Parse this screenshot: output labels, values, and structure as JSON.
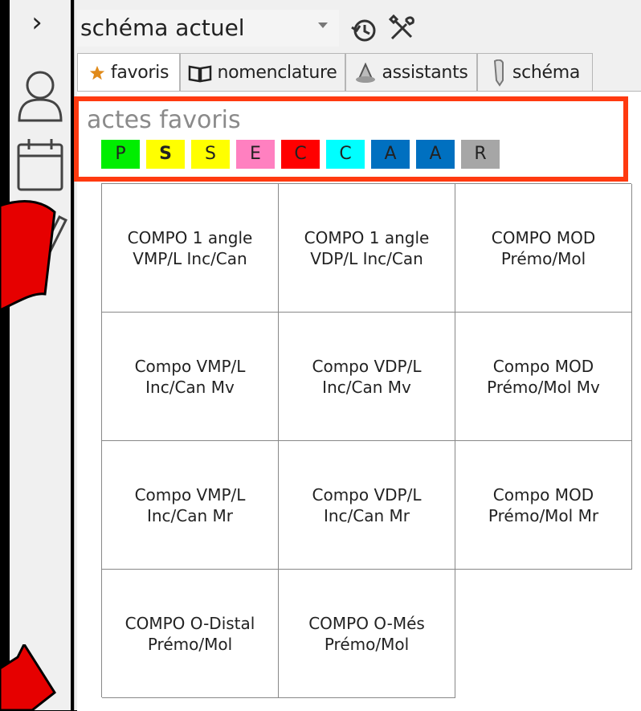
{
  "left_panel": {
    "expand_glyph": "›",
    "icons": [
      "chevron-right-icon",
      "user-icon",
      "calendar-icon",
      "person-edit-icon"
    ]
  },
  "schema": {
    "selected": "schéma actuel",
    "icons": [
      "history-icon",
      "tools-icon"
    ]
  },
  "tabs": [
    {
      "label": "favoris",
      "icon": "star-icon",
      "active": true
    },
    {
      "label": "nomenclature",
      "icon": "book-icon",
      "active": false
    },
    {
      "label": "assistants",
      "icon": "wizard-icon",
      "active": false
    },
    {
      "label": "schéma",
      "icon": "tooth-icon",
      "active": false
    }
  ],
  "favorites": {
    "title": "actes favoris",
    "swatches": [
      {
        "letter": "P",
        "color": "#00ee00",
        "bold": false
      },
      {
        "letter": "S",
        "color": "#ffff00",
        "bold": true
      },
      {
        "letter": "S",
        "color": "#ffff00",
        "bold": false
      },
      {
        "letter": "E",
        "color": "#ff80c0",
        "bold": false
      },
      {
        "letter": "C",
        "color": "#ff0000",
        "bold": false
      },
      {
        "letter": "C",
        "color": "#00ffff",
        "bold": false
      },
      {
        "letter": "A",
        "color": "#0070c0",
        "bold": false
      },
      {
        "letter": "A",
        "color": "#0070c0",
        "bold": false
      },
      {
        "letter": "R",
        "color": "#a6a6a6",
        "bold": false
      }
    ],
    "grid": [
      [
        "COMPO 1 angle\nVMP/L Inc/Can",
        "COMPO 1 angle\nVDP/L Inc/Can",
        "COMPO MOD\nPrémo/Mol"
      ],
      [
        "Compo VMP/L\nInc/Can Mv",
        "Compo VDP/L\nInc/Can Mv",
        "Compo MOD\nPrémo/Mol Mv"
      ],
      [
        "Compo VMP/L\nInc/Can Mr",
        "Compo VDP/L\nInc/Can Mr",
        "Compo MOD\nPrémo/Mol Mr"
      ],
      [
        "COMPO O-Distal\nPrémo/Mol",
        "COMPO O-Més\nPrémo/Mol",
        ""
      ]
    ]
  },
  "colors": {
    "highlight_border": "#ff3a10",
    "arrow_red": "#e60000"
  }
}
